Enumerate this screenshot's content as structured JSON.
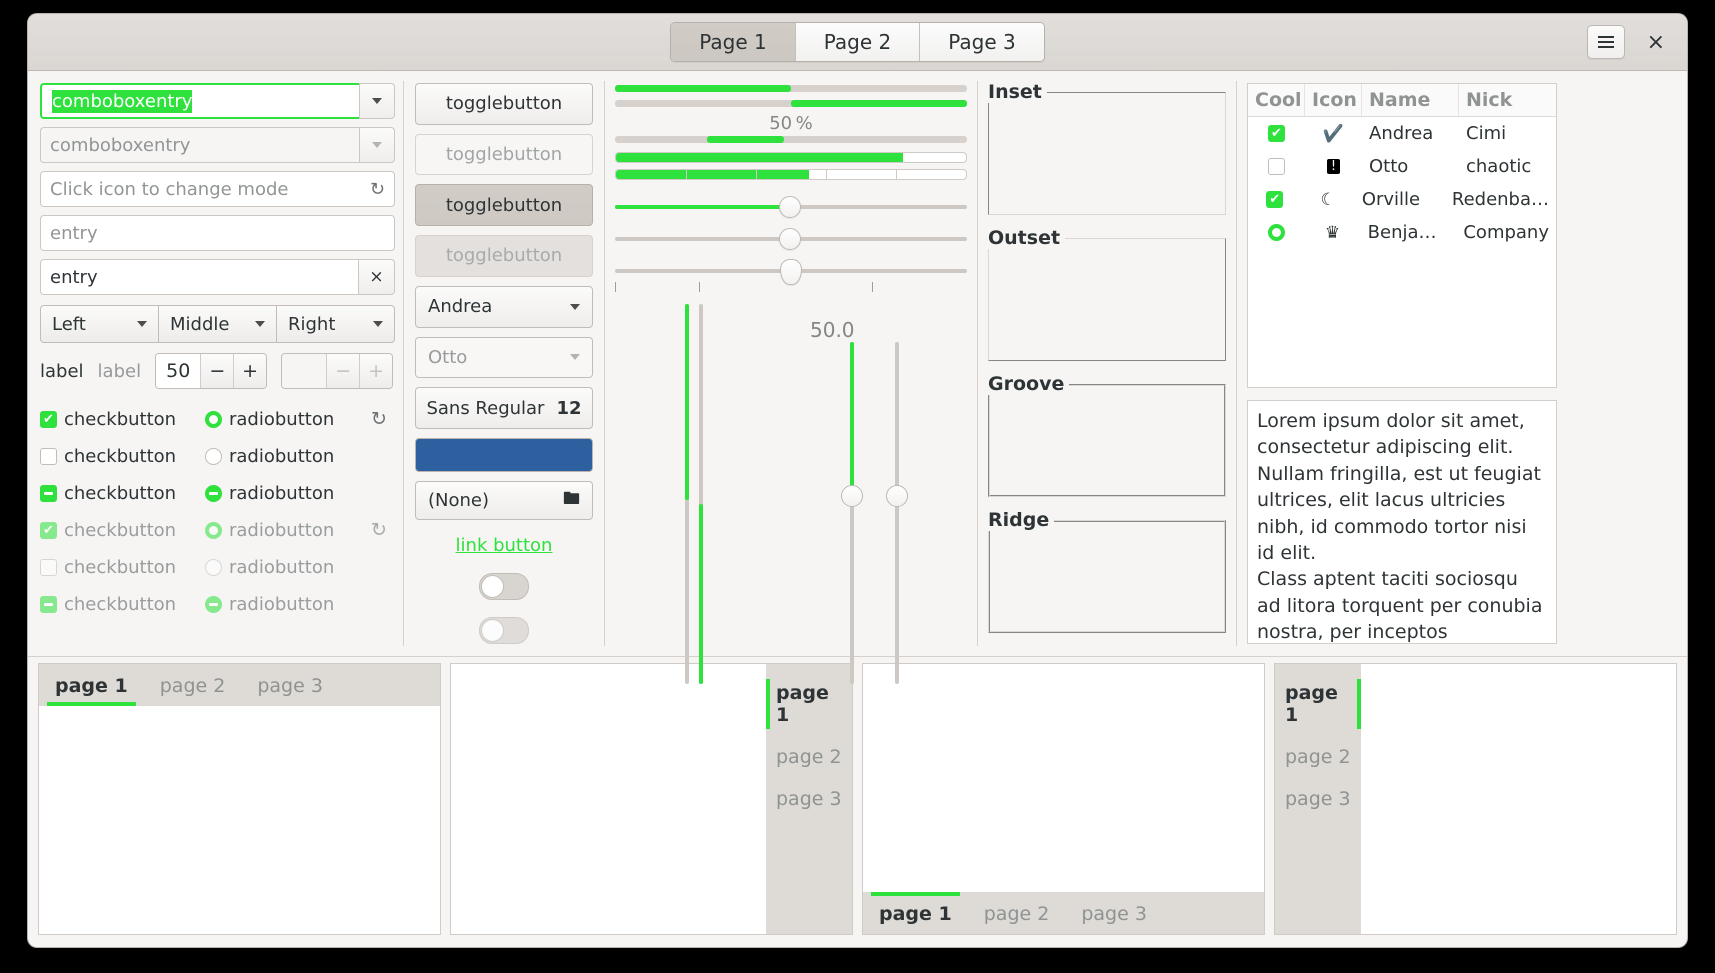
{
  "header": {
    "tabs": [
      {
        "label": "Page 1",
        "active": true
      },
      {
        "label": "Page 2",
        "active": false
      },
      {
        "label": "Page 3",
        "active": false
      }
    ],
    "menu_icon": "hamburger-menu-icon",
    "close_label": "×"
  },
  "entries": {
    "combo_focused_value": "comboboxentry",
    "combo_dim_value": "comboboxentry",
    "icon_entry_placeholder": "Click icon to change mode",
    "icon_entry_icon": "refresh-icon",
    "plain_entry_placeholder": "entry",
    "clear_entry_value": "entry",
    "clear_icon": "×"
  },
  "button_box": {
    "items": [
      "Left",
      "Middle",
      "Right"
    ]
  },
  "label_row": {
    "label1": "label",
    "label2": "label",
    "spin_value": "50",
    "spin_minus": "−",
    "spin_plus": "+",
    "spin_disabled_value": "",
    "spin_disabled_minus": "−",
    "spin_disabled_plus": "+"
  },
  "check_rows": [
    {
      "check_label": "checkbutton",
      "check_state": "on",
      "radio_label": "radiobutton",
      "radio_state": "on",
      "spinner": true,
      "dim": false
    },
    {
      "check_label": "checkbutton",
      "check_state": "off",
      "radio_label": "radiobutton",
      "radio_state": "off",
      "spinner": false,
      "dim": false
    },
    {
      "check_label": "checkbutton",
      "check_state": "mixed",
      "radio_label": "radiobutton",
      "radio_state": "mixed",
      "spinner": false,
      "dim": false
    },
    {
      "check_label": "checkbutton",
      "check_state": "on",
      "radio_label": "radiobutton",
      "radio_state": "on",
      "spinner": true,
      "dim": true
    },
    {
      "check_label": "checkbutton",
      "check_state": "off",
      "radio_label": "radiobutton",
      "radio_state": "off",
      "spinner": false,
      "dim": true
    },
    {
      "check_label": "checkbutton",
      "check_state": "mixed",
      "radio_label": "radiobutton",
      "radio_state": "mixed",
      "spinner": false,
      "dim": true
    }
  ],
  "toggles": {
    "toggle1": "togglebutton",
    "toggle2": "togglebutton",
    "toggle3": "togglebutton",
    "toggle4": "togglebutton",
    "combo_name": "Andrea",
    "combo_name_disabled": "Otto",
    "font_name": "Sans Regular",
    "font_size": "12",
    "color_value": "#2e5f9e",
    "file_label": "(None)",
    "file_icon": "folder-open-icon",
    "link_label": "link button"
  },
  "scales": {
    "progress_percent_label": "50 %",
    "progress1_fraction": 50,
    "progress2_fraction": 50,
    "progress3_fraction": 22,
    "level1_fraction": 82,
    "level2_fraction": 55,
    "hscale1_value": 50,
    "hscale2_value": 50,
    "hscale3_value": 50,
    "scale_value_label": "50.0",
    "vscale_values": [
      50,
      50,
      50,
      50
    ]
  },
  "frames": [
    {
      "title": "Inset",
      "style": "inset"
    },
    {
      "title": "Outset",
      "style": "outset"
    },
    {
      "title": "Groove",
      "style": "groove"
    },
    {
      "title": "Ridge",
      "style": "ridge"
    }
  ],
  "treeview": {
    "columns": [
      "Cool",
      "Icon",
      "Name",
      "Nick"
    ],
    "rows": [
      {
        "cool": "on",
        "icon": "✔",
        "icon_name": "check-circle-icon",
        "name": "Andrea",
        "nick": "Cimi"
      },
      {
        "cool": "off",
        "icon": "!",
        "icon_name": "warning-icon",
        "name": "Otto",
        "nick": "chaotic"
      },
      {
        "cool": "on",
        "icon": "☾",
        "icon_name": "moon-icon",
        "name": "Orville",
        "nick": "Redenba…"
      },
      {
        "cool": "radio",
        "icon": "♛",
        "icon_name": "crown-icon",
        "name": "Benja…",
        "nick": "Company"
      }
    ]
  },
  "textview": {
    "paragraph1": "Lorem ipsum dolor sit amet, consectetur adipiscing elit. Nullam fringilla, est ut feugiat ultrices, elit lacus ultricies nibh, id commodo tortor nisi id elit.",
    "paragraph2": "Class aptent taciti sociosqu ad litora torquent per conubia nostra, per inceptos himenaeos."
  },
  "notebooks": [
    {
      "position": "top",
      "tabs": [
        {
          "label": "page 1",
          "active": true
        },
        {
          "label": "page 2",
          "active": false
        },
        {
          "label": "page 3",
          "active": false
        }
      ]
    },
    {
      "position": "right",
      "tabs": [
        {
          "label": "page 1",
          "active": true
        },
        {
          "label": "page 2",
          "active": false
        },
        {
          "label": "page 3",
          "active": false
        }
      ]
    },
    {
      "position": "bottom",
      "tabs": [
        {
          "label": "page 1",
          "active": true
        },
        {
          "label": "page 2",
          "active": false
        },
        {
          "label": "page 3",
          "active": false
        }
      ]
    },
    {
      "position": "left",
      "tabs": [
        {
          "label": "page 1",
          "active": true
        },
        {
          "label": "page 2",
          "active": false
        },
        {
          "label": "page 3",
          "active": false
        }
      ]
    }
  ],
  "colors": {
    "accent_green": "#2ee13c",
    "window_bg": "#f6f5f4",
    "header_bg": "#dedad6",
    "color_button": "#2e5f9e"
  }
}
